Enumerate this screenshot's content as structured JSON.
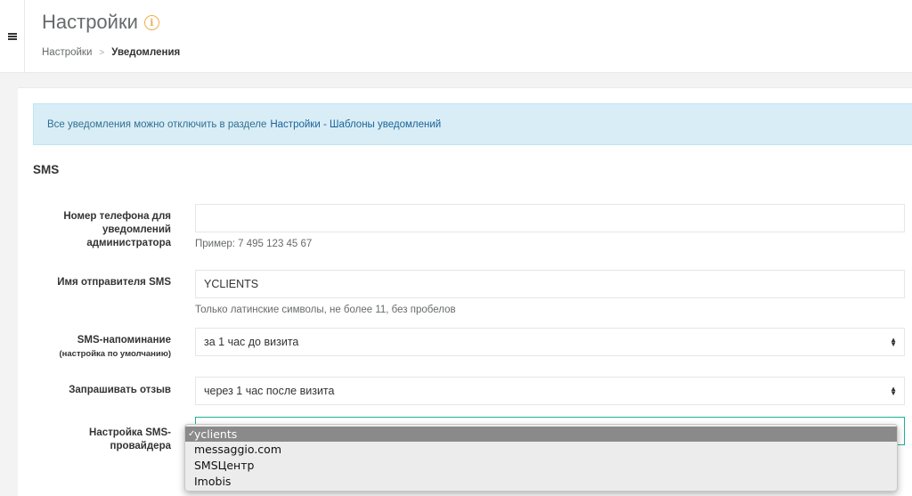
{
  "header": {
    "title": "Настройки",
    "info_icon": "i",
    "breadcrumb": {
      "root": "Настройки",
      "separator": ">",
      "current": "Уведомления"
    }
  },
  "alert": {
    "text": "Все уведомления можно отключить в разделе",
    "link": "Настройки - Шаблоны уведомлений"
  },
  "section": {
    "title": "SMS"
  },
  "form": {
    "admin_phone": {
      "label": "Номер телефона для уведомлений администратора",
      "value": "",
      "help": "Пример: 7 495 123 45 67"
    },
    "sender_name": {
      "label": "Имя отправителя SMS",
      "value": "YCLIENTS",
      "help": "Только латинские символы, не более 11, без пробелов"
    },
    "sms_reminder": {
      "label": "SMS-напоминание",
      "sublabel": "(настройка по умолчанию)",
      "value": "за 1 час до визита"
    },
    "ask_review": {
      "label": "Запрашивать отзыв",
      "value": "через 1 час после визита"
    },
    "sms_provider": {
      "label_line1": "Настройка SMS-",
      "label_line2": "провайдера",
      "selected": "yclients",
      "options": [
        "yclients",
        "messaggio.com",
        "SMSЦентр",
        "Imobis"
      ]
    }
  },
  "colors": {
    "accent": "#1ab394",
    "alert_bg": "#d9edf7",
    "alert_text": "#31708f",
    "info_icon": "#f0ad4e"
  },
  "icons": {
    "menu": "hamburger-icon",
    "info": "info-circle-icon",
    "select": "select-updown-icon",
    "checkmark": "checkmark-icon"
  }
}
